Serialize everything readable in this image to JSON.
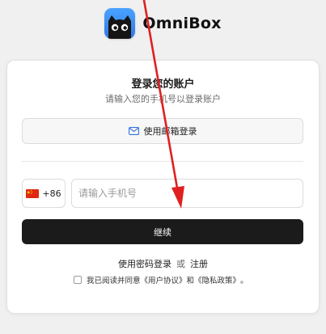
{
  "header": {
    "brand": "OmniBox",
    "logo_icon": "cat-face-icon",
    "logo_color": "#3a8ef0"
  },
  "login": {
    "title": "登录您的账户",
    "subtitle": "请输入您的手机号以登录账户",
    "email_button_label": "使用邮箱登录",
    "email_icon": "mail-icon",
    "country_flag_icon": "china-flag-icon",
    "country_code": "+86",
    "phone_placeholder": "请输入手机号",
    "phone_value": "",
    "continue_label": "继续",
    "continue_color": "#1b1b1b",
    "password_login_label": "使用密码登录",
    "or_label": "或",
    "register_label": "注册",
    "agree": {
      "checked": false,
      "prefix": "我已阅读并同意",
      "user_agreement": "《用户协议》",
      "and": "和",
      "privacy_policy": "《隐私政策》",
      "suffix": "。"
    }
  },
  "overlay": {
    "arrow_icon": "red-arrow-annotation",
    "arrow_color": "#e02020"
  }
}
